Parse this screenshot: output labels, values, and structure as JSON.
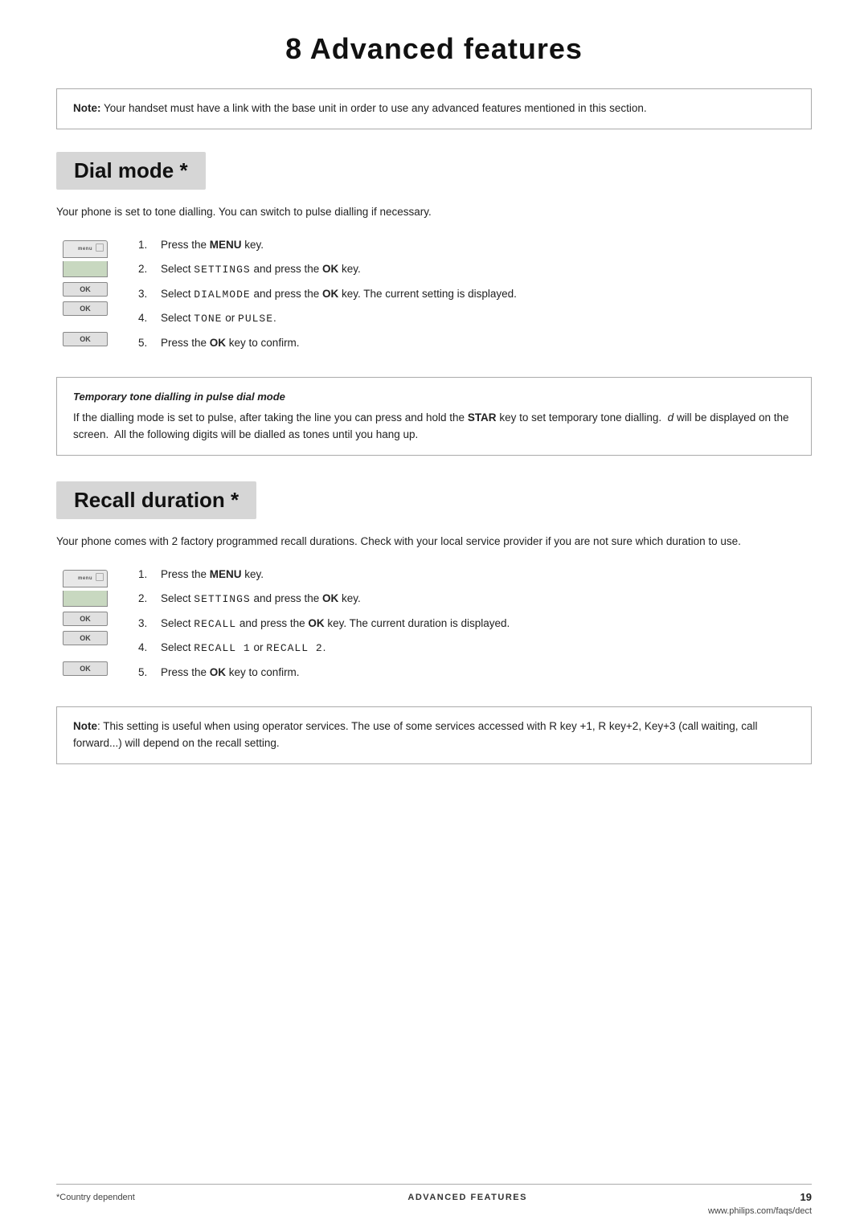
{
  "page": {
    "chapter": "8   Advanced features",
    "footer": {
      "left_note": "*Country dependent",
      "center_text": "ADVANCED FEATURES",
      "page_number": "19",
      "url": "www.philips.com/faqs/dect"
    }
  },
  "top_note": {
    "label": "Note:",
    "text": " Your handset must have a link with the base unit in order to use any advanced features mentioned in this section."
  },
  "dial_mode": {
    "heading": "Dial mode *",
    "intro": "Your phone is set to tone dialling. You can switch to pulse dialling if necessary.",
    "steps": [
      {
        "num": "1.",
        "text_parts": [
          {
            "text": "Press the ",
            "bold": false
          },
          {
            "text": "MENU",
            "bold": true
          },
          {
            "text": " key.",
            "bold": false
          }
        ]
      },
      {
        "num": "2.",
        "text_parts": [
          {
            "text": "Select ",
            "bold": false
          },
          {
            "text": "SETTINGS",
            "mono": true
          },
          {
            "text": " and press the ",
            "bold": false
          },
          {
            "text": "OK",
            "bold": true
          },
          {
            "text": " key.",
            "bold": false
          }
        ]
      },
      {
        "num": "3.",
        "text_parts": [
          {
            "text": "Select ",
            "bold": false
          },
          {
            "text": "DIALMODE",
            "mono": true
          },
          {
            "text": " and press the ",
            "bold": false
          },
          {
            "text": "OK",
            "bold": true
          },
          {
            "text": " key.  The current setting is displayed.",
            "bold": false
          }
        ]
      },
      {
        "num": "4.",
        "text_parts": [
          {
            "text": "Select ",
            "bold": false
          },
          {
            "text": "TONE",
            "mono": true
          },
          {
            "text": " or ",
            "bold": false
          },
          {
            "text": "PULSE",
            "mono": true
          },
          {
            "text": ".",
            "bold": false
          }
        ]
      },
      {
        "num": "5.",
        "text_parts": [
          {
            "text": "Press the ",
            "bold": false
          },
          {
            "text": "OK",
            "bold": true
          },
          {
            "text": " key to confirm.",
            "bold": false
          }
        ]
      }
    ],
    "tip": {
      "title": "Temporary tone dialling in pulse dial mode",
      "text_parts": [
        {
          "text": "If the dialling mode is set to pulse, after taking the line you can press and hold the ",
          "bold": false
        },
        {
          "text": "STAR",
          "bold": true
        },
        {
          "text": " key to set temporary tone dialling.  ",
          "bold": false
        },
        {
          "text": "d",
          "italic": true
        },
        {
          "text": " will be displayed on the screen.  All the following digits will be dialled as tones until you hang up.",
          "bold": false
        }
      ]
    }
  },
  "recall_duration": {
    "heading": "Recall duration *",
    "intro": "Your phone comes with 2 factory programmed recall durations.  Check with your local service provider if you are not sure which duration to use.",
    "steps": [
      {
        "num": "1.",
        "text_parts": [
          {
            "text": "Press the ",
            "bold": false
          },
          {
            "text": "MENU",
            "bold": true
          },
          {
            "text": " key.",
            "bold": false
          }
        ]
      },
      {
        "num": "2.",
        "text_parts": [
          {
            "text": "Select ",
            "bold": false
          },
          {
            "text": "SETTINGS",
            "mono": true
          },
          {
            "text": " and press the ",
            "bold": false
          },
          {
            "text": "OK",
            "bold": true
          },
          {
            "text": " key.",
            "bold": false
          }
        ]
      },
      {
        "num": "3.",
        "text_parts": [
          {
            "text": "Select ",
            "bold": false
          },
          {
            "text": "RECALL",
            "mono": true
          },
          {
            "text": " and press the ",
            "bold": false
          },
          {
            "text": "OK",
            "bold": true
          },
          {
            "text": " key.  The current duration is displayed.",
            "bold": false
          }
        ]
      },
      {
        "num": "4.",
        "text_parts": [
          {
            "text": "Select ",
            "bold": false
          },
          {
            "text": "RECALL 1",
            "mono": true
          },
          {
            "text": " or ",
            "bold": false
          },
          {
            "text": "RECALL 2",
            "mono": true
          },
          {
            "text": ".",
            "bold": false
          }
        ]
      },
      {
        "num": "5.",
        "text_parts": [
          {
            "text": "Press the ",
            "bold": false
          },
          {
            "text": "OK",
            "bold": true
          },
          {
            "text": " key to confirm.",
            "bold": false
          }
        ]
      }
    ],
    "note": {
      "label": "Note",
      "text": ": This setting is useful when using operator services.  The use of some services accessed with R key +1, R key+2, Key+3 (call waiting, call forward...) will depend on the recall setting."
    }
  }
}
